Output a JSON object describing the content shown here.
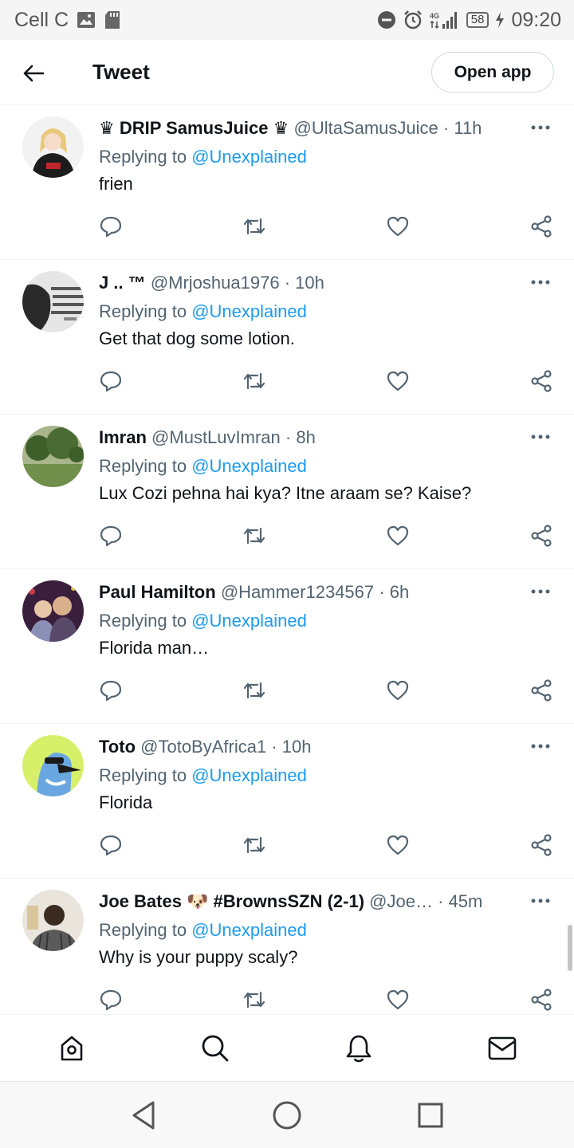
{
  "status_bar": {
    "carrier": "Cell C",
    "network": "4G",
    "battery": "58",
    "time": "09:20"
  },
  "header": {
    "title": "Tweet",
    "open_app_label": "Open app"
  },
  "tweets": [
    {
      "name": "♛ DRIP SamusJuice ♛",
      "handle": "@UltaSamusJuice",
      "time": "· 11h",
      "replying_label": "Replying to",
      "mention": "@Unexplained",
      "text": "frien",
      "avatar_colors": [
        "#f2f2f2",
        "#1c1c1c",
        "#e8c87a"
      ]
    },
    {
      "name": "J .. ™",
      "handle": "@Mrjoshua1976",
      "time": "· 10h",
      "replying_label": "Replying to",
      "mention": "@Unexplained",
      "text": "Get that dog some lotion.",
      "avatar_colors": [
        "#e6e6e6",
        "#2a2a2a",
        "#888888"
      ]
    },
    {
      "name": "Imran",
      "handle": "@MustLuvImran",
      "time": "· 8h",
      "replying_label": "Replying to",
      "mention": "@Unexplained",
      "text": "Lux Cozi pehna hai kya? Itne araam se? Kaise?",
      "avatar_colors": [
        "#6f8f4a",
        "#3f5f2a",
        "#a9b58a"
      ]
    },
    {
      "name": "Paul Hamilton",
      "handle": "@Hammer1234567",
      "time": "· 6h",
      "replying_label": "Replying to",
      "mention": "@Unexplained",
      "text": "Florida man…",
      "avatar_colors": [
        "#3a1f3d",
        "#c93a4a",
        "#d9b08c"
      ]
    },
    {
      "name": "Toto",
      "handle": "@TotoByAfrica1",
      "time": "· 10h",
      "replying_label": "Replying to",
      "mention": "@Unexplained",
      "text": "Florida",
      "avatar_colors": [
        "#d7f06a",
        "#6aa6e0",
        "#1a1a1a"
      ]
    },
    {
      "name": "Joe Bates 🐶 #BrownsSZN (2-1)",
      "handle": "@Joe…",
      "time": "· 45m",
      "replying_label": "Replying to",
      "mention": "@Unexplained",
      "text": "Why is your puppy scaly?",
      "avatar_colors": [
        "#e9e4dc",
        "#3a2a20",
        "#5a5a5a"
      ]
    }
  ],
  "tab_bar": [
    "home-icon",
    "search-icon",
    "notifications-icon",
    "messages-icon"
  ],
  "nav_bar": [
    "back-triangle-icon",
    "home-circle-icon",
    "recents-square-icon"
  ],
  "colors": {
    "accent": "#1d9bf0",
    "secondary_text": "#536471",
    "divider": "#eff3f4"
  }
}
